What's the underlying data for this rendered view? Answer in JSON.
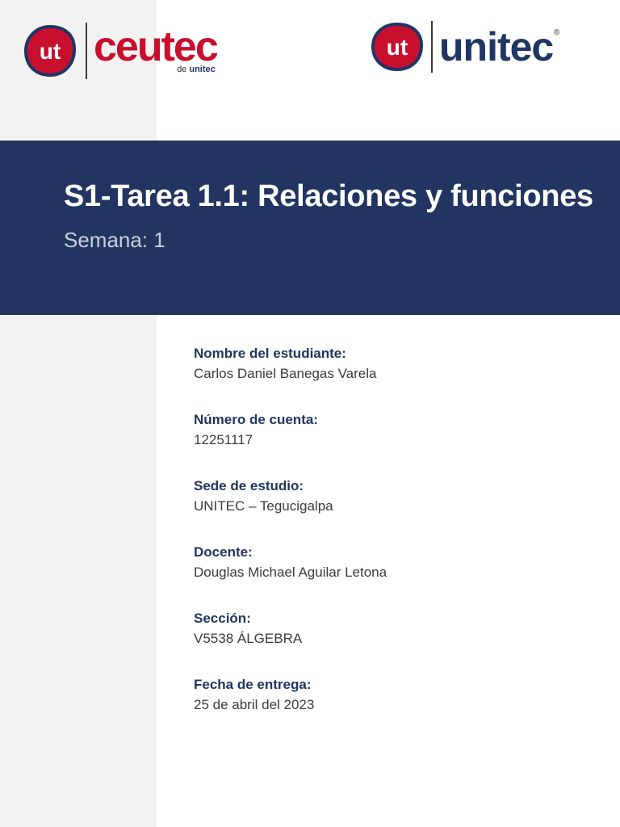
{
  "logos": {
    "ceutec": {
      "badge": "ut",
      "word": "ceutec",
      "sub_prefix": "de ",
      "sub_name": "unitec"
    },
    "unitec": {
      "badge": "ut",
      "word": "unitec",
      "registered": "®"
    }
  },
  "colors": {
    "brand_red": "#c8102e",
    "brand_navy": "#213560",
    "sidebar": "#f2f2f2"
  },
  "header": {
    "title": "S1-Tarea 1.1: Relaciones y funciones",
    "subtitle": "Semana: 1"
  },
  "fields": [
    {
      "label": "Nombre del estudiante:",
      "value": "Carlos Daniel Banegas Varela"
    },
    {
      "label": "Número de cuenta:",
      "value": "12251117"
    },
    {
      "label": "Sede de estudio:",
      "value": "UNITEC – Tegucigalpa"
    },
    {
      "label": "Docente:",
      "value": "Douglas Michael Aguilar Letona"
    },
    {
      "label": "Sección:",
      "value": "V5538 ÁLGEBRA"
    },
    {
      "label": "Fecha de entrega:",
      "value": "25 de abril del 2023"
    }
  ]
}
